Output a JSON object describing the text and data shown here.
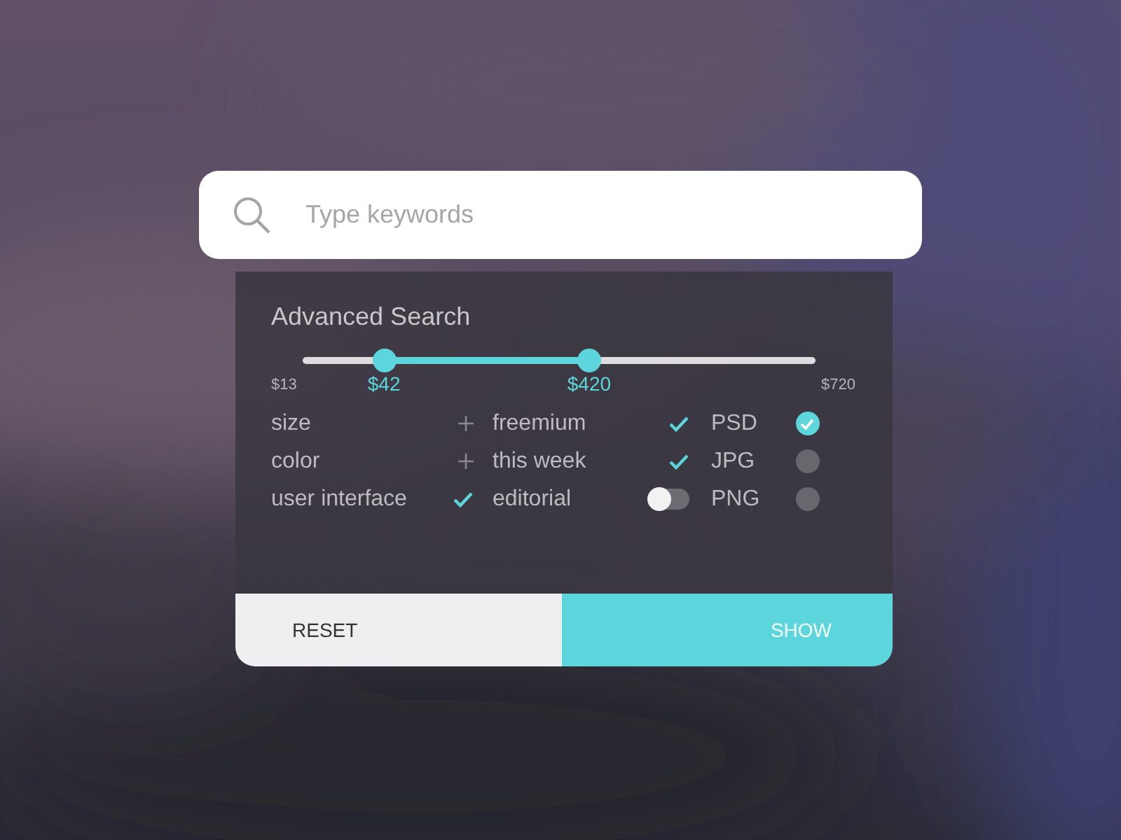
{
  "search": {
    "placeholder": "Type keywords"
  },
  "panel": {
    "title": "Advanced Search",
    "slider": {
      "min_label": "$13",
      "max_label": "$720",
      "handles": [
        {
          "label": "$42",
          "level": 0.16
        },
        {
          "label": "$420",
          "level": 0.56
        }
      ]
    },
    "columns": [
      {
        "items": [
          {
            "label": "size",
            "kind": "check",
            "checked": false
          },
          {
            "label": "color",
            "kind": "check",
            "checked": false
          },
          {
            "label": "user interface",
            "kind": "check",
            "checked": true
          }
        ]
      },
      {
        "items": [
          {
            "label": "freemium",
            "kind": "check",
            "checked": true
          },
          {
            "label": "this week",
            "kind": "check",
            "checked": true
          },
          {
            "label": "editorial",
            "kind": "toggle",
            "on": false
          }
        ]
      },
      {
        "items": [
          {
            "label": "PSD",
            "kind": "radio",
            "selected": true
          },
          {
            "label": "JPG",
            "kind": "radio",
            "selected": false
          },
          {
            "label": "PNG",
            "kind": "radio",
            "selected": false
          }
        ]
      }
    ]
  },
  "buttons": [
    {
      "label": "RESET",
      "kind": "secondary"
    },
    {
      "label": "SHOW",
      "kind": "primary"
    }
  ]
}
